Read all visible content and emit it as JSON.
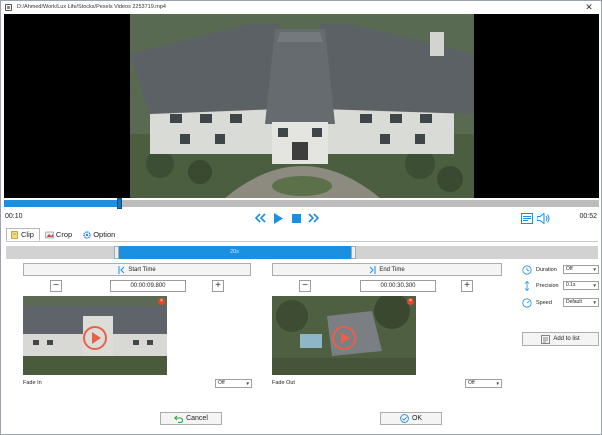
{
  "window": {
    "title": "D:/Ahmed/Work/Lux Life/Stocks/Pexels Videos 2253719.mp4",
    "close_glyph": "✕"
  },
  "player": {
    "current_time": "00:10",
    "total_time": "00:52",
    "progress_fraction": 0.193,
    "icons": [
      "rewind-icon",
      "play-icon",
      "stop-icon",
      "fast-forward-icon",
      "subtitle-icon",
      "volume-icon"
    ]
  },
  "tabs": [
    {
      "label": "Clip",
      "icon": "clip-icon",
      "active": true
    },
    {
      "label": "Crop",
      "icon": "crop-icon",
      "active": false
    },
    {
      "label": "Option",
      "icon": "gear-icon",
      "active": false
    }
  ],
  "clip_range": {
    "label": "20s",
    "start_fraction": 0.19,
    "end_fraction": 0.582
  },
  "start": {
    "button_label": "Start Time",
    "time_value": "00:00:09.800",
    "minus": "−",
    "plus": "+",
    "fade_label": "Fade In",
    "fade_value": "Off"
  },
  "end": {
    "button_label": "End Time",
    "time_value": "00:00:30.300",
    "minus": "−",
    "plus": "+",
    "fade_label": "Fade Out",
    "fade_value": "Off"
  },
  "settings": {
    "duration_label": "Duration",
    "duration_value": "Off",
    "precision_label": "Precision",
    "precision_value": "0.1s",
    "speed_label": "Speed",
    "speed_value": "Default",
    "add_to_list_label": "Add to list"
  },
  "footer": {
    "cancel_label": "Cancel",
    "ok_label": "OK"
  },
  "colors": {
    "accent": "#1b8fe0",
    "seek_track": "#bdbdbd",
    "delete_badge": "#e04a2a"
  }
}
